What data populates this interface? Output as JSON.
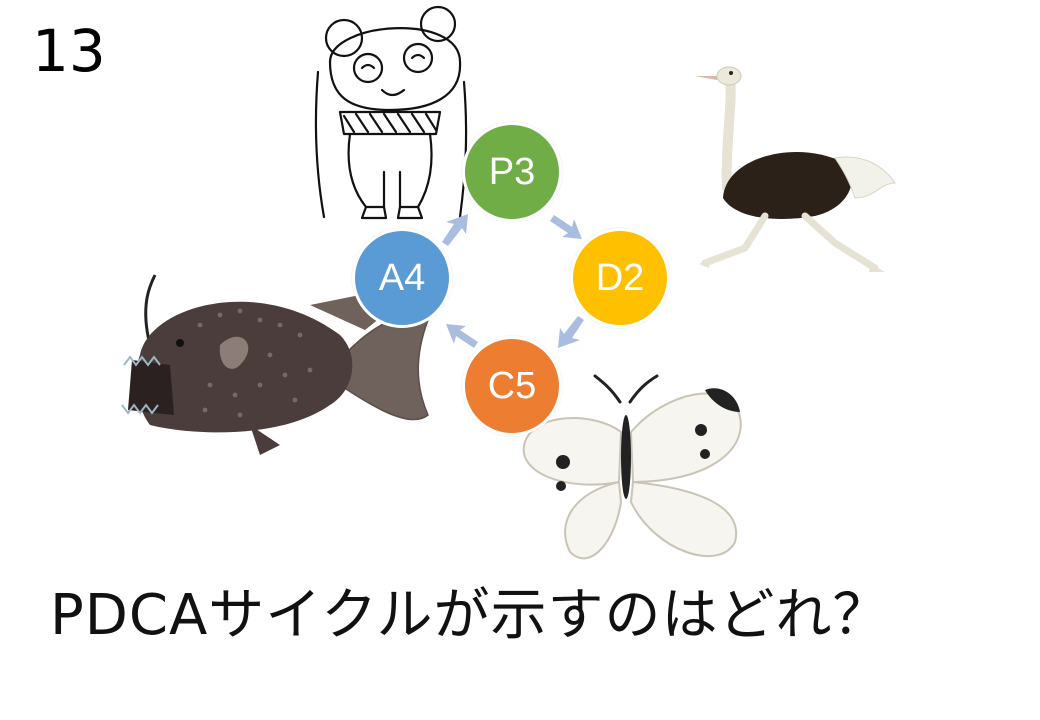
{
  "slide": {
    "number": "13"
  },
  "cycle": {
    "nodes": [
      {
        "label": "P3",
        "color": "#70AD47"
      },
      {
        "label": "D2",
        "color": "#FFC000"
      },
      {
        "label": "C5",
        "color": "#ED7D31"
      },
      {
        "label": "A4",
        "color": "#5B9BD5"
      }
    ],
    "arrow_color": "#A9BDE0"
  },
  "illustrations": [
    {
      "name": "panda",
      "icon": "panda-sketch-icon"
    },
    {
      "name": "ostrich",
      "icon": "ostrich-icon"
    },
    {
      "name": "anglerfish",
      "icon": "anglerfish-icon"
    },
    {
      "name": "butterfly",
      "icon": "cabbage-white-butterfly-icon"
    }
  ],
  "question": {
    "text": "PDCAサイクルが示すのはどれ？"
  }
}
